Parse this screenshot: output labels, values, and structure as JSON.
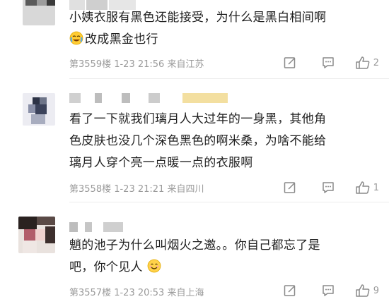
{
  "comments": [
    {
      "text_lines": [
        "小姨衣服有黑色还能接受，为什么是黑白相间啊",
        "改成黑金也行"
      ],
      "emoji": "crying-laughing-emoji",
      "meta": "第3559楼 1-23 21:56 来自江苏",
      "like_count": "2"
    },
    {
      "text_lines": [
        "看了一下就我们璃月人大过年的一身黑，其他角",
        "色皮肤也没几个深色黑色的啊米桑，为啥不能给",
        "璃月人穿个亮一点暖一点的衣服啊"
      ],
      "meta": "第3558楼 1-23 21:21 来自四川",
      "like_count": "1"
    },
    {
      "text_lines": [
        "魈的池子为什么叫烟火之邀。。你自己都忘了是",
        "吧，你个见人"
      ],
      "emoji": "smiling-emoji",
      "meta": "第3557楼 1-23 20:53 来自上海",
      "like_count": "9"
    }
  ],
  "icons": [
    "edit-icon",
    "comment-icon",
    "like-icon"
  ],
  "colors": {
    "text": "#1f1f1f",
    "meta": "#9a9a9a",
    "divider": "#ececec",
    "icon": "#8a8a8a"
  }
}
